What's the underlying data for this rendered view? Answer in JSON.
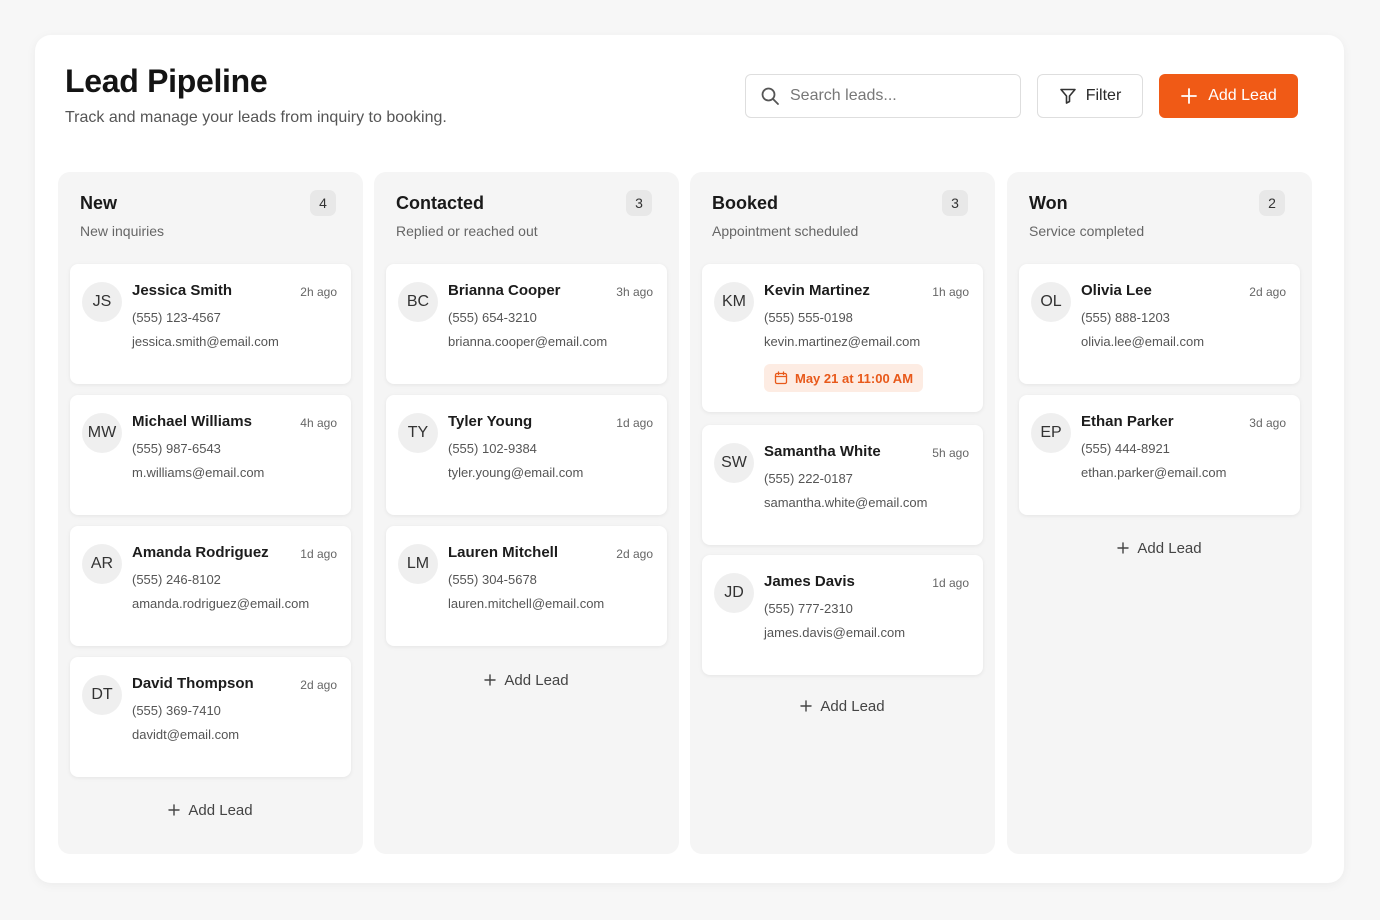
{
  "header": {
    "title": "Lead Pipeline",
    "subtitle": "Track and manage your leads from inquiry to booking.",
    "search_placeholder": "Search leads...",
    "filter_label": "Filter",
    "add_label": "Add Lead",
    "accent_color": "#f05a16"
  },
  "columns": [
    {
      "title": "New",
      "subtitle": "New inquiries",
      "count": "4",
      "add_label": "Add Lead",
      "leads": [
        {
          "initials": "JS",
          "name": "Jessica Smith",
          "time": "2h ago",
          "phone": "(555) 123-4567",
          "email": "jessica.smith@email.com"
        },
        {
          "initials": "MW",
          "name": "Michael Williams",
          "time": "4h ago",
          "phone": "(555) 987-6543",
          "email": "m.williams@email.com"
        },
        {
          "initials": "AR",
          "name": "Amanda Rodriguez",
          "time": "1d ago",
          "phone": "(555) 246-8102",
          "email": "amanda.rodriguez@email.com"
        },
        {
          "initials": "DT",
          "name": "David Thompson",
          "time": "2d ago",
          "phone": "(555) 369-7410",
          "email": "davidt@email.com"
        }
      ]
    },
    {
      "title": "Contacted",
      "subtitle": "Replied or reached out",
      "count": "3",
      "add_label": "Add Lead",
      "leads": [
        {
          "initials": "BC",
          "name": "Brianna Cooper",
          "time": "3h ago",
          "phone": "(555) 654-3210",
          "email": "brianna.cooper@email.com"
        },
        {
          "initials": "TY",
          "name": "Tyler Young",
          "time": "1d ago",
          "phone": "(555) 102-9384",
          "email": "tyler.young@email.com"
        },
        {
          "initials": "LM",
          "name": "Lauren Mitchell",
          "time": "2d ago",
          "phone": "(555) 304-5678",
          "email": "lauren.mitchell@email.com"
        }
      ]
    },
    {
      "title": "Booked",
      "subtitle": "Appointment scheduled",
      "count": "3",
      "add_label": "Add Lead",
      "leads": [
        {
          "initials": "KM",
          "name": "Kevin Martinez",
          "time": "1h ago",
          "phone": "(555) 555-0198",
          "email": "kevin.martinez@email.com",
          "appointment": "May 21 at 11:00 AM"
        },
        {
          "initials": "SW",
          "name": "Samantha White",
          "time": "5h ago",
          "phone": "(555) 222-0187",
          "email": "samantha.white@email.com"
        },
        {
          "initials": "JD",
          "name": "James Davis",
          "time": "1d ago",
          "phone": "(555) 777-2310",
          "email": "james.davis@email.com"
        }
      ]
    },
    {
      "title": "Won",
      "subtitle": "Service completed",
      "count": "2",
      "add_label": "Add Lead",
      "leads": [
        {
          "initials": "OL",
          "name": "Olivia Lee",
          "time": "2d ago",
          "phone": "(555) 888-1203",
          "email": "olivia.lee@email.com"
        },
        {
          "initials": "EP",
          "name": "Ethan Parker",
          "time": "3d ago",
          "phone": "(555) 444-8921",
          "email": "ethan.parker@email.com"
        }
      ]
    }
  ]
}
